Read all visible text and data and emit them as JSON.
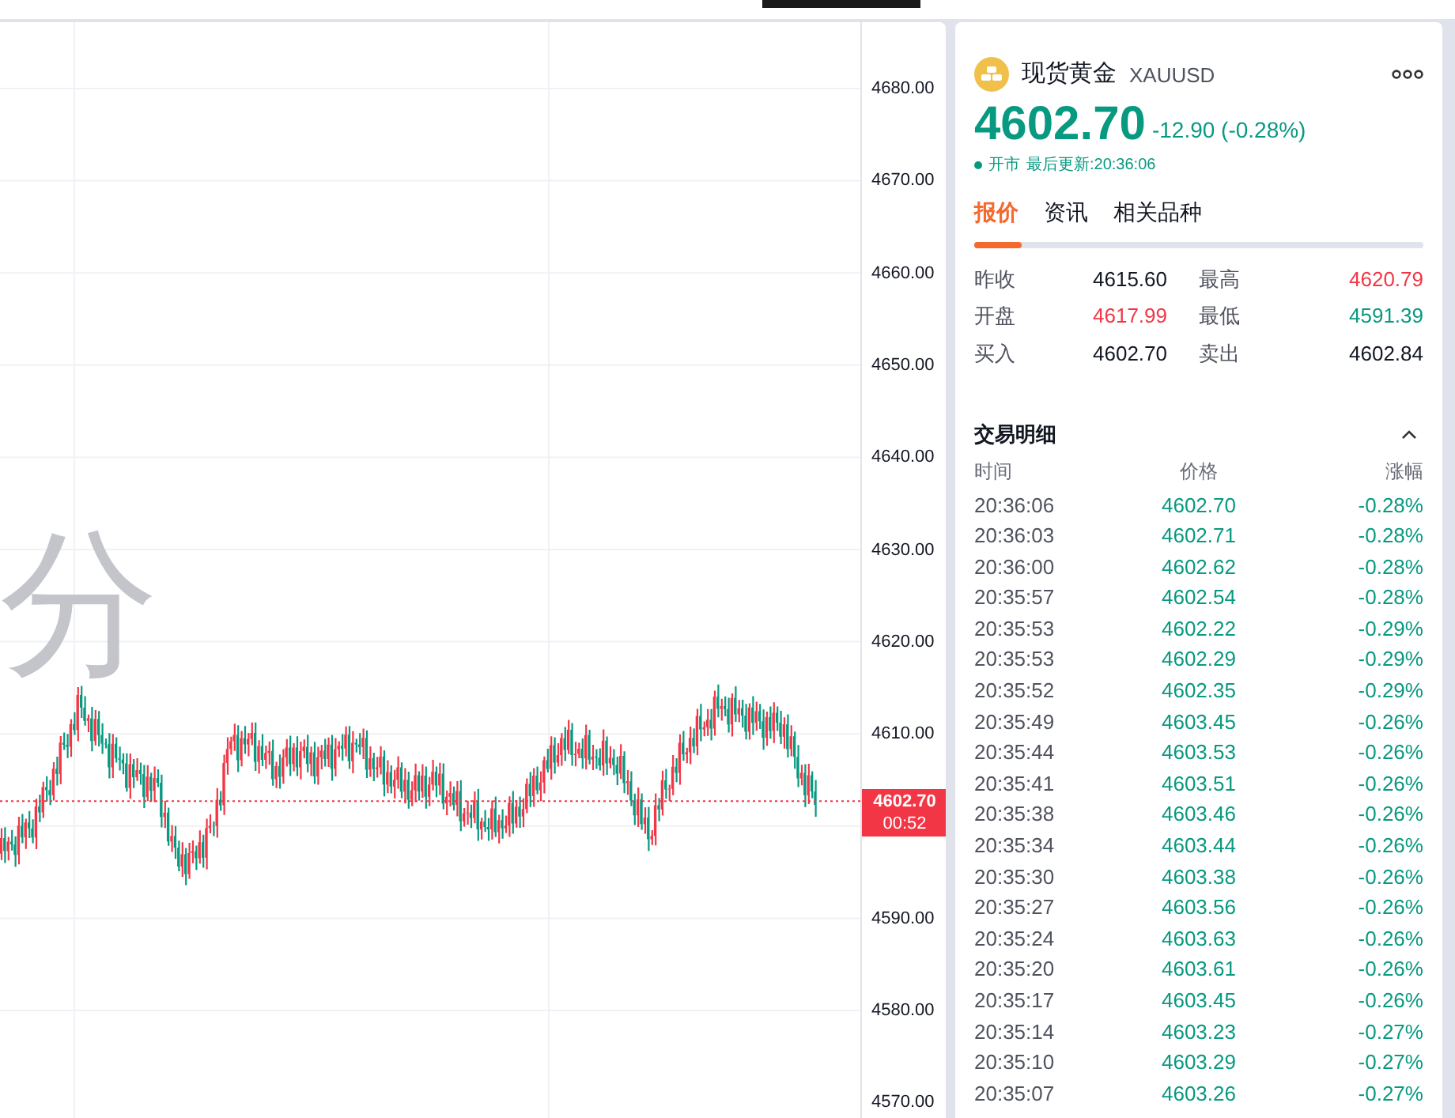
{
  "chart": {
    "watermark": "分",
    "y_axis_labels": [
      "4680.00",
      "4670.00",
      "4660.00",
      "4650.00",
      "4640.00",
      "4630.00",
      "4620.00",
      "4610.00",
      "4590.00",
      "4580.00",
      "4570.00"
    ],
    "last_price": {
      "price": "4602.70",
      "countdown": "00:52"
    }
  },
  "quote": {
    "name": "现货黄金",
    "symbol": "XAUUSD",
    "price": "4602.70",
    "change": "-12.90 (-0.28%)",
    "status": "开市",
    "updated": "最后更新:20:36:06",
    "tabs": [
      {
        "label": "报价",
        "selected": true
      },
      {
        "label": "资讯",
        "selected": false
      },
      {
        "label": "相关品种",
        "selected": false
      }
    ],
    "stats": [
      {
        "label": "昨收",
        "value": "4615.60",
        "color": "#131722"
      },
      {
        "label": "最高",
        "value": "4620.79",
        "color": "#f23645"
      },
      {
        "label": "开盘",
        "value": "4617.99",
        "color": "#f23645"
      },
      {
        "label": "最低",
        "value": "4591.39",
        "color": "#089981"
      },
      {
        "label": "买入",
        "value": "4602.70",
        "color": "#131722"
      },
      {
        "label": "卖出",
        "value": "4602.84",
        "color": "#131722"
      }
    ]
  },
  "trades": {
    "title": "交易明细",
    "expanded": true,
    "columns": [
      "时间",
      "价格",
      "涨幅"
    ],
    "rows": [
      [
        "20:36:06",
        "4602.70",
        "-0.28%"
      ],
      [
        "20:36:03",
        "4602.71",
        "-0.28%"
      ],
      [
        "20:36:00",
        "4602.62",
        "-0.28%"
      ],
      [
        "20:35:57",
        "4602.54",
        "-0.28%"
      ],
      [
        "20:35:53",
        "4602.22",
        "-0.29%"
      ],
      [
        "20:35:53",
        "4602.29",
        "-0.29%"
      ],
      [
        "20:35:52",
        "4602.35",
        "-0.29%"
      ],
      [
        "20:35:49",
        "4603.45",
        "-0.26%"
      ],
      [
        "20:35:44",
        "4603.53",
        "-0.26%"
      ],
      [
        "20:35:41",
        "4603.51",
        "-0.26%"
      ],
      [
        "20:35:38",
        "4603.46",
        "-0.26%"
      ],
      [
        "20:35:34",
        "4603.44",
        "-0.26%"
      ],
      [
        "20:35:30",
        "4603.38",
        "-0.26%"
      ],
      [
        "20:35:27",
        "4603.56",
        "-0.26%"
      ],
      [
        "20:35:24",
        "4603.63",
        "-0.26%"
      ],
      [
        "20:35:20",
        "4603.61",
        "-0.26%"
      ],
      [
        "20:35:17",
        "4603.45",
        "-0.26%"
      ],
      [
        "20:35:14",
        "4603.23",
        "-0.27%"
      ],
      [
        "20:35:10",
        "4603.29",
        "-0.27%"
      ],
      [
        "20:35:07",
        "4603.26",
        "-0.27%"
      ]
    ]
  }
}
